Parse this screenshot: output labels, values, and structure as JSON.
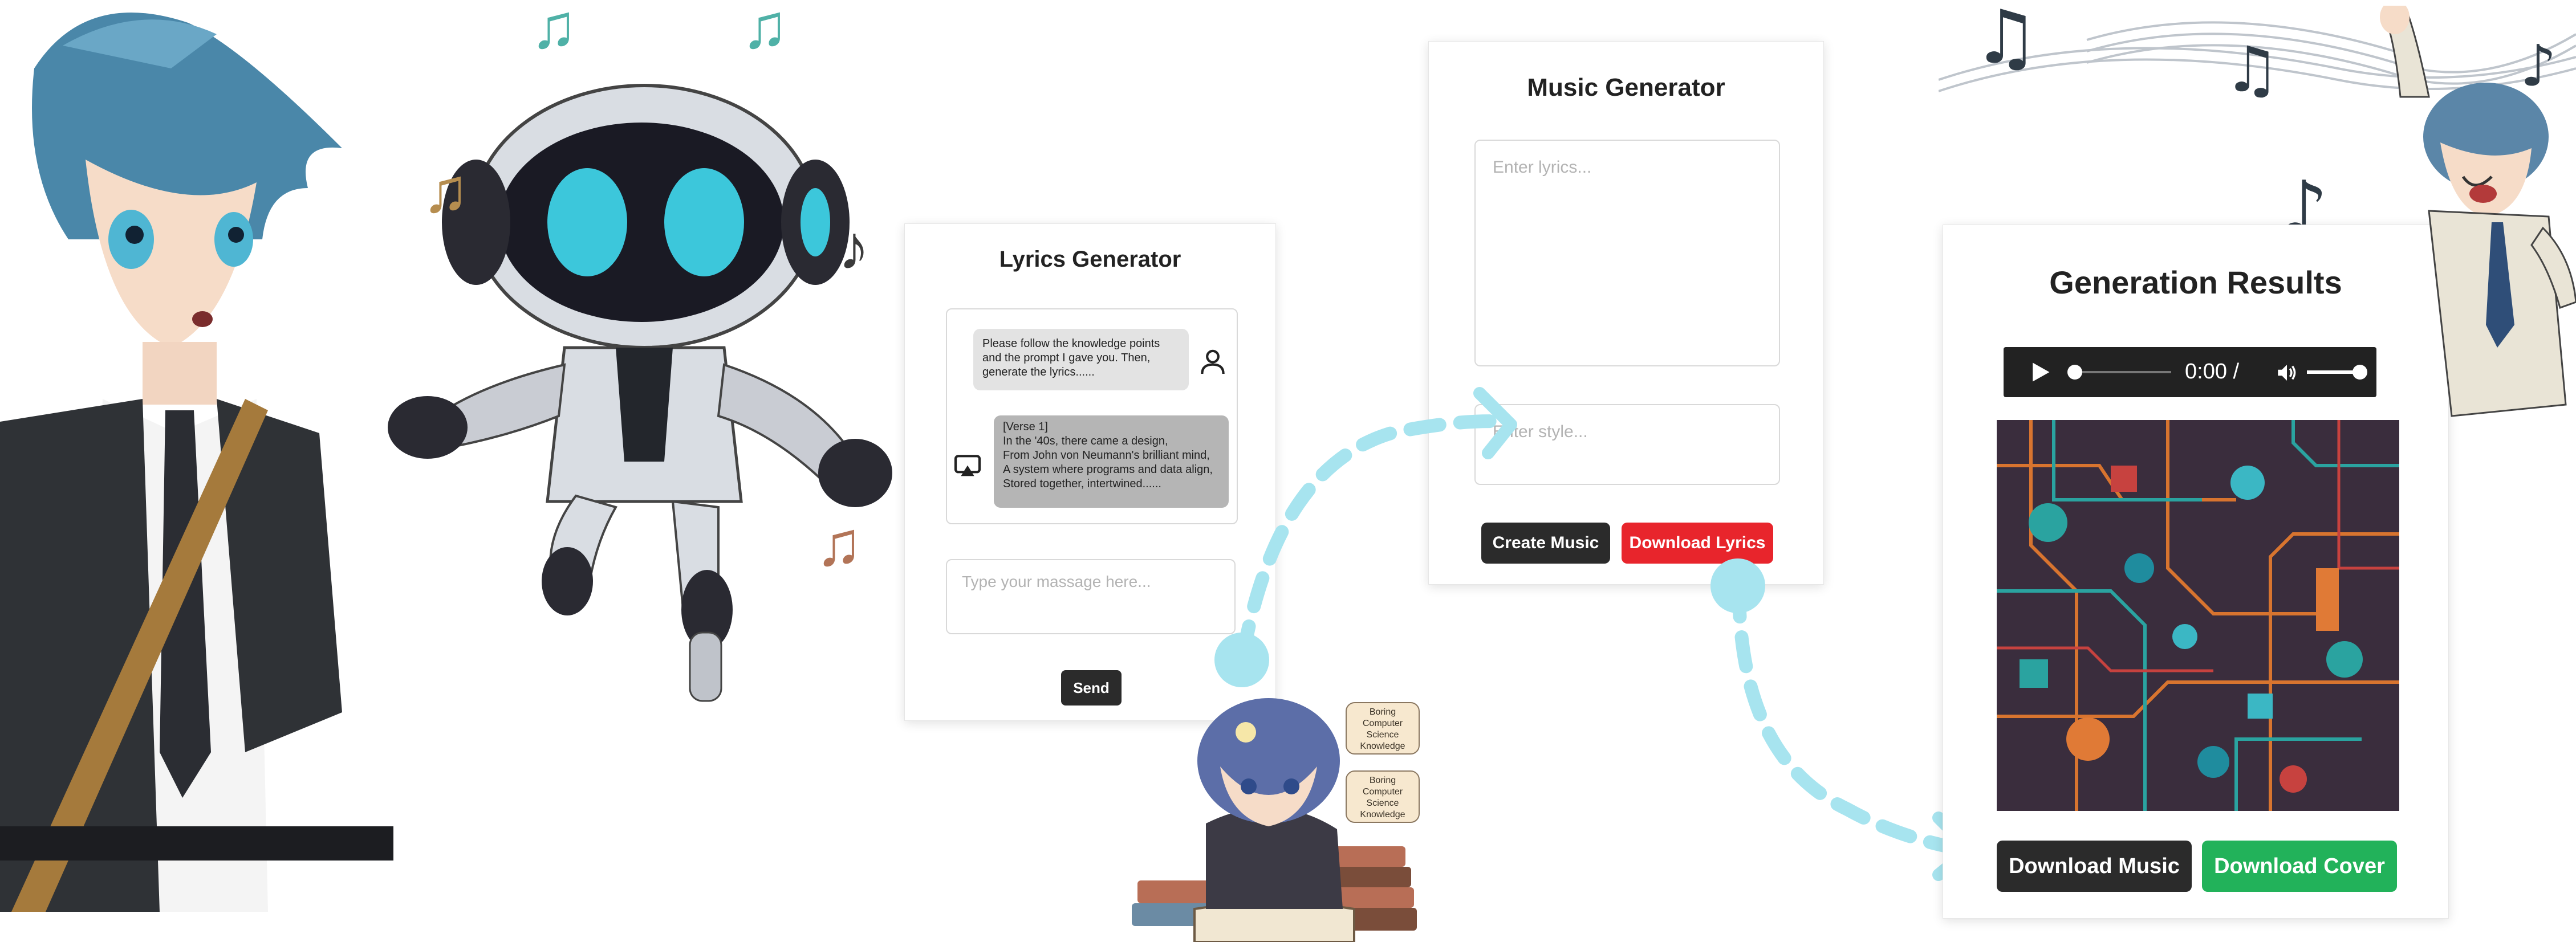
{
  "lyrics_panel": {
    "title": "Lyrics Generator",
    "user_message": "Please follow the knowledge points and the prompt I gave you. Then, generate the lyrics......",
    "bot_message_lines": [
      "[Verse 1]",
      "In the '40s, there came a design,",
      "From John von Neumann's brilliant mind,",
      "A system where programs and data align,",
      "Stored together, intertwined......"
    ],
    "input_placeholder": "Type  your massage here...",
    "send_label": "Send"
  },
  "music_panel": {
    "title": "Music Generator",
    "lyrics_placeholder": "Enter lyrics...",
    "style_placeholder": "Enter style...",
    "create_label": "Create Music",
    "download_lyrics_label": "Download Lyrics"
  },
  "results_panel": {
    "title": "Generation Results",
    "player_time": "0:00 /",
    "download_music_label": "Download Music",
    "download_cover_label": "Download Cover"
  },
  "sticky_notes": {
    "note_1": [
      "Boring",
      "Computer Science",
      "Knowledge"
    ],
    "note_2": [
      "Boring",
      "Computer Science",
      "Knowledge"
    ]
  },
  "colors": {
    "dark_button": "#2b2b2b",
    "red_button": "#e8252c",
    "green_button": "#22b25a",
    "arrow": "#a7e4ef",
    "notes": "#4fb1a7"
  },
  "icons": {
    "user": "user-icon",
    "bot": "bot-icon",
    "play": "play-icon",
    "volume": "volume-icon"
  }
}
